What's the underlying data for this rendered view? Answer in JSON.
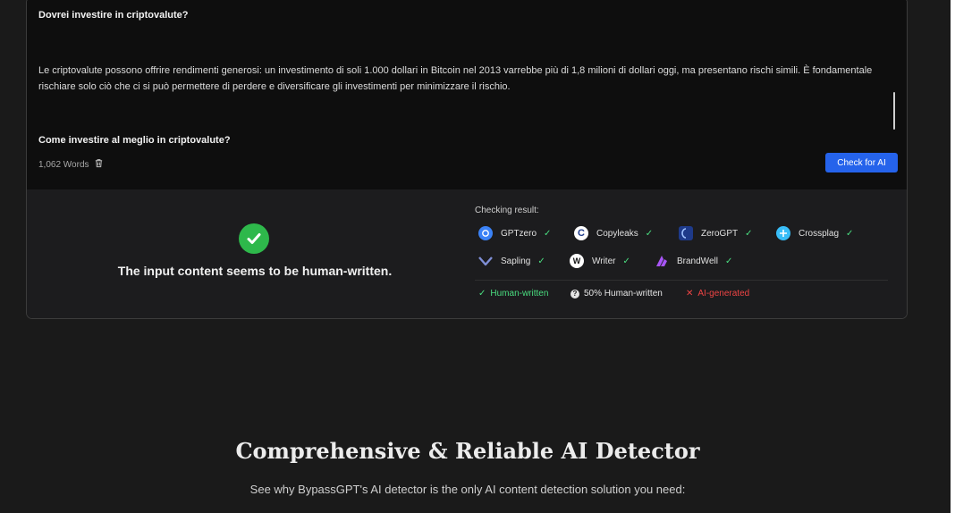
{
  "editor": {
    "question_1": "Dovrei investire in criptovalute?",
    "paragraph": "Le criptovalute possono offrire rendimenti generosi: un investimento di soli 1.000 dollari in Bitcoin nel 2013 varrebbe più di 1,8 milioni di dollari oggi, ma presentano rischi simili. È fondamentale rischiare solo ciò che ci si può permettere di perdere e diversificare gli investimenti per minimizzare il rischio.",
    "question_2": "Come investire al meglio in criptovalute?",
    "word_count": "1,062 Words",
    "check_button": "Check for AI"
  },
  "result": {
    "verdict": "The input content seems to be human-written.",
    "checking_label": "Checking result:",
    "detectors": [
      {
        "name": "GPTzero",
        "icon": "gptzero-icon",
        "color": "#3b82f6"
      },
      {
        "name": "Copyleaks",
        "icon": "copyleaks-icon",
        "color": "#2563eb"
      },
      {
        "name": "ZeroGPT",
        "icon": "zerogpt-icon",
        "color": "#1e3a8a"
      },
      {
        "name": "Crossplag",
        "icon": "crossplag-icon",
        "color": "#38bdf8"
      },
      {
        "name": "Sapling",
        "icon": "sapling-icon",
        "color": "#6b7ec9"
      },
      {
        "name": "Writer",
        "icon": "writer-icon",
        "color": "#ffffff"
      },
      {
        "name": "BrandWell",
        "icon": "brandwell-icon",
        "color": "#a855f7"
      }
    ],
    "legend": {
      "human": "Human-written",
      "half": "50% Human-written",
      "ai": "AI-generated"
    },
    "colors": {
      "human": "#4ade80",
      "half": "#e5e5e5",
      "ai": "#ef4444",
      "accent": "#2563eb"
    }
  },
  "section": {
    "heading": "Comprehensive & Reliable AI Detector",
    "subtext": "See why BypassGPT's AI detector is the only AI content detection solution you need:"
  }
}
